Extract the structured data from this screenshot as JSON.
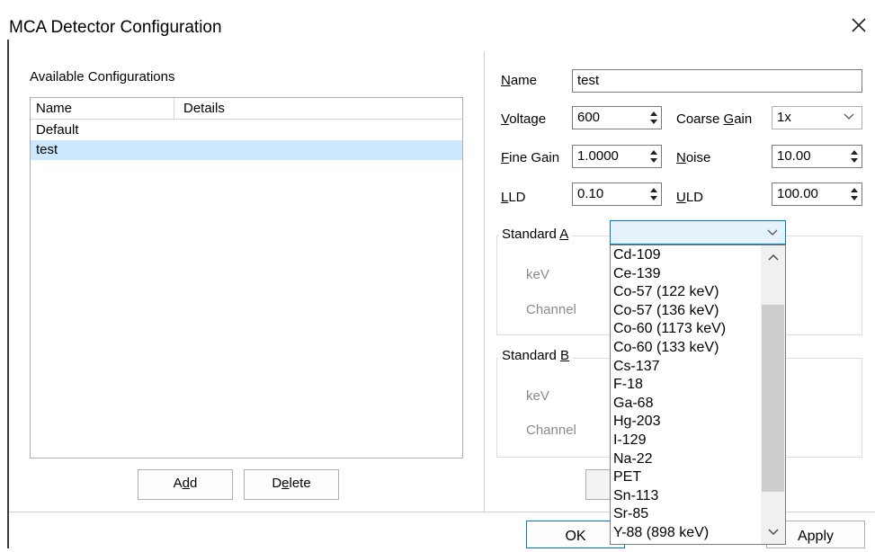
{
  "window": {
    "title": "MCA Detector Configuration",
    "close_icon": "close-icon"
  },
  "configurations": {
    "label": "Available Configurations",
    "columns": [
      "Name",
      "Details"
    ],
    "rows": [
      {
        "name": "Default",
        "details": "",
        "selected": false
      },
      {
        "name": "test",
        "details": "",
        "selected": true
      }
    ],
    "add_button": "Add",
    "delete_button": "Delete"
  },
  "form": {
    "name_label": "Name",
    "name_value": "test",
    "voltage_label": "Voltage",
    "voltage_value": "600",
    "coarse_gain_label": "Coarse Gain",
    "coarse_gain_value": "1x",
    "fine_gain_label": "Fine Gain",
    "fine_gain_value": "1.0000",
    "noise_label": "Noise",
    "noise_value": "10.00",
    "lld_label": "LLD",
    "lld_value": "0.10",
    "uld_label": "ULD",
    "uld_value": "100.00"
  },
  "standard_a": {
    "title": "Standard A",
    "kev_label": "keV",
    "channel_label": "Channel",
    "selected_value": ""
  },
  "standard_b": {
    "title": "Standard B",
    "kev_label": "keV",
    "channel_label": "Channel"
  },
  "dropdown_items": [
    "Cd-109",
    "Ce-139",
    "Co-57 (122 keV)",
    "Co-57 (136 keV)",
    "Co-60 (1173 keV)",
    "Co-60 (133 keV)",
    "Cs-137",
    "F-18",
    "Ga-68",
    "Hg-203",
    "I-129",
    "Na-22",
    "PET",
    "Sn-113",
    "Sr-85",
    "Y-88 (898 keV)"
  ],
  "footer": {
    "ok_button": "OK",
    "apply_button": "Apply"
  },
  "colors": {
    "selection": "#cce8ff",
    "focus_border": "#0078d7"
  }
}
